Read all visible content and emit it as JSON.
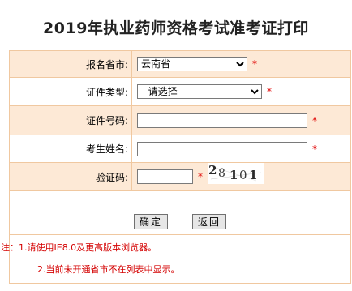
{
  "title": "2019年执业药师资格考试准考证打印",
  "form": {
    "province_label": "报名省市:",
    "province_value": "云南省",
    "id_type_label": "证件类型:",
    "id_type_value": "--请选择--",
    "id_no_label": "证件号码:",
    "name_label": "考生姓名:",
    "captcha_label": "验证码:",
    "required_mark": "*",
    "captcha_text": "28101"
  },
  "buttons": {
    "confirm_label": "确定",
    "back_label": "返回"
  },
  "notes": {
    "line1": "注：1.请使用IE8.0及更高版本浏览器。",
    "line2": "2.当前未开通省市不在列表中显示。"
  },
  "colors": {
    "row_tint": "#fde9d6",
    "border": "#f0c8a0",
    "required": "#e00000",
    "notes_text": "#d40000"
  }
}
